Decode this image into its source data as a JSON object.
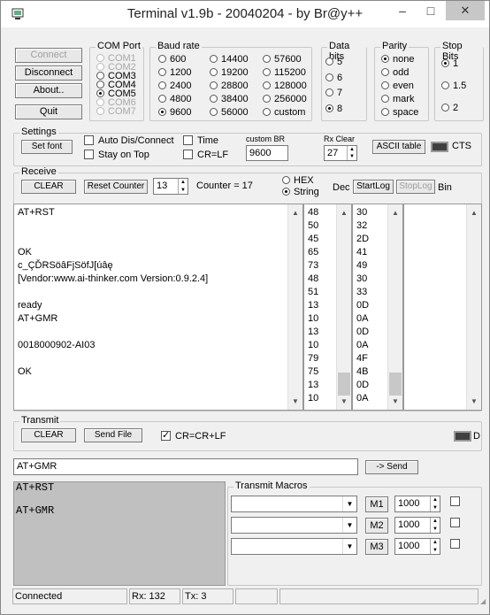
{
  "window": {
    "title": "Terminal v1.9b - 20040204 - by Br@y++",
    "minimize": "–",
    "maximize": "□",
    "close": "✕"
  },
  "connection_buttons": {
    "connect": "Connect",
    "disconnect": "Disconnect",
    "about": "About..",
    "quit": "Quit"
  },
  "com_port": {
    "title": "COM Port",
    "options": [
      "COM1",
      "COM2",
      "COM3",
      "COM4",
      "COM5",
      "COM6",
      "COM7"
    ],
    "selected": "COM5"
  },
  "baud_rate": {
    "title": "Baud rate",
    "options": [
      "600",
      "1200",
      "2400",
      "4800",
      "9600",
      "14400",
      "19200",
      "28800",
      "38400",
      "56000",
      "57600",
      "115200",
      "128000",
      "256000",
      "custom"
    ],
    "selected": "9600"
  },
  "data_bits": {
    "title": "Data bits",
    "options": [
      "5",
      "6",
      "7",
      "8"
    ],
    "selected": "8"
  },
  "parity": {
    "title": "Parity",
    "options": [
      "none",
      "odd",
      "even",
      "mark",
      "space"
    ],
    "selected": "none"
  },
  "stop_bits": {
    "title": "Stop Bits",
    "options": [
      "1",
      "1.5",
      "2"
    ],
    "selected": "1"
  },
  "settings": {
    "title": "Settings",
    "set_font": "Set font",
    "auto_dis_connect": "Auto Dis/Connect",
    "stay_on_top": "Stay on Top",
    "time": "Time",
    "cr_lf": "CR=LF",
    "custom_br_label": "custom BR",
    "custom_br_value": "9600",
    "rx_clear_label": "Rx Clear",
    "rx_clear_value": "27",
    "ascii_table": "ASCII table",
    "cts": "CTS"
  },
  "receive": {
    "title": "Receive",
    "clear": "CLEAR",
    "reset_counter": "Reset Counter",
    "counter_spin": "13",
    "counter_label": "Counter = 17",
    "hex": "HEX",
    "string": "String",
    "mode_selected": "String",
    "dec": "Dec",
    "start_log": "StartLog",
    "stop_log": "StopLog",
    "bin": "Bin",
    "text_lines": [
      "AT+RST",
      "",
      "",
      "OK",
      "c_ÇĎRSöâFjSöfJ[úâę",
      "[Vendor:www.ai-thinker.com Version:0.9.2.4]",
      "",
      "ready",
      "AT+GMR",
      "",
      "0018000902-AI03",
      "",
      "OK"
    ],
    "dec_values": [
      "48",
      "50",
      "45",
      "65",
      "73",
      "48",
      "51",
      "13",
      "10",
      "13",
      "10",
      "79",
      "75",
      "13",
      "10"
    ],
    "hex_values": [
      "30",
      "32",
      "2D",
      "41",
      "49",
      "30",
      "33",
      "0D",
      "0A",
      "0D",
      "0A",
      "4F",
      "4B",
      "0D",
      "0A"
    ]
  },
  "transmit": {
    "title": "Transmit",
    "clear": "CLEAR",
    "send_file": "Send File",
    "cr_cr_lf": "CR=CR+LF",
    "dtr_label": "D",
    "input_value": "AT+GMR",
    "send": "-> Send",
    "history_lines": [
      "AT+RST",
      "",
      "AT+GMR"
    ]
  },
  "macros": {
    "title": "Transmit Macros",
    "rows": [
      {
        "button": "M1",
        "interval": "1000"
      },
      {
        "button": "M2",
        "interval": "1000"
      },
      {
        "button": "M3",
        "interval": "1000"
      }
    ]
  },
  "status": {
    "connection": "Connected",
    "rx": "Rx: 132",
    "tx": "Tx: 3"
  }
}
